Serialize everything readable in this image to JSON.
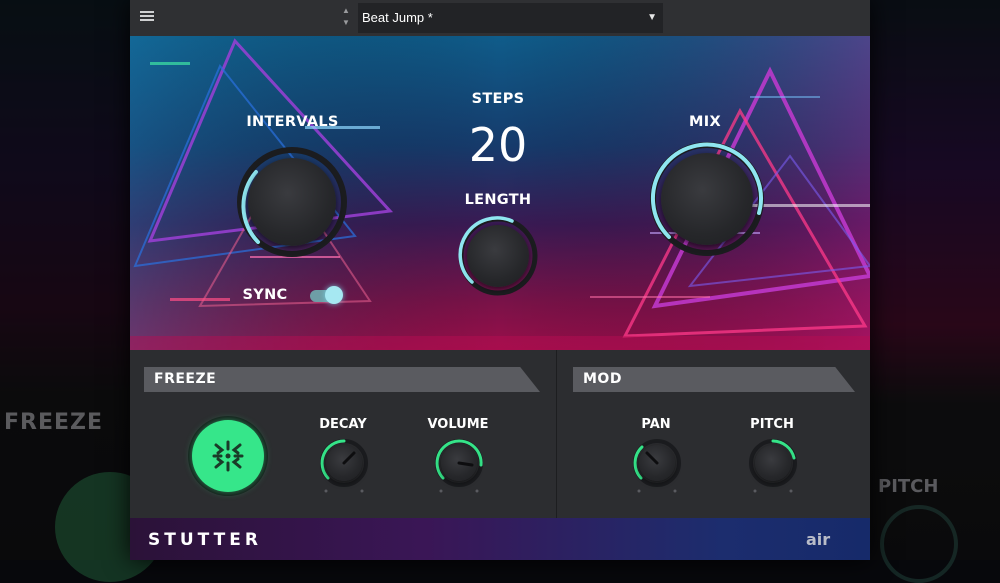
{
  "background": {
    "freeze_label": "FREEZE",
    "pitch_label": "PITCH"
  },
  "topbar": {
    "preset_name": "Beat Jump *",
    "menu_icon": "hamburger-icon",
    "preset_prev_icon": "arrow-up-icon",
    "preset_next_icon": "arrow-down-icon",
    "dropdown_icon": "caret-down-icon"
  },
  "hero": {
    "intervals_label": "INTERVALS",
    "steps_label": "STEPS",
    "steps_value": "20",
    "length_label": "LENGTH",
    "mix_label": "MIX",
    "sync_label": "SYNC",
    "sync_on": true
  },
  "freeze": {
    "header": "FREEZE",
    "decay_label": "DECAY",
    "volume_label": "VOLUME",
    "freeze_icon": "freeze-icon"
  },
  "mod": {
    "header": "MOD",
    "pan_label": "PAN",
    "pitch_label": "PITCH"
  },
  "footer": {
    "title": "STUTTER",
    "logo_text": "air"
  },
  "colors": {
    "accent_cyan": "#8fe6f0",
    "accent_green": "#36e68a",
    "panel": "#2c2d30"
  }
}
